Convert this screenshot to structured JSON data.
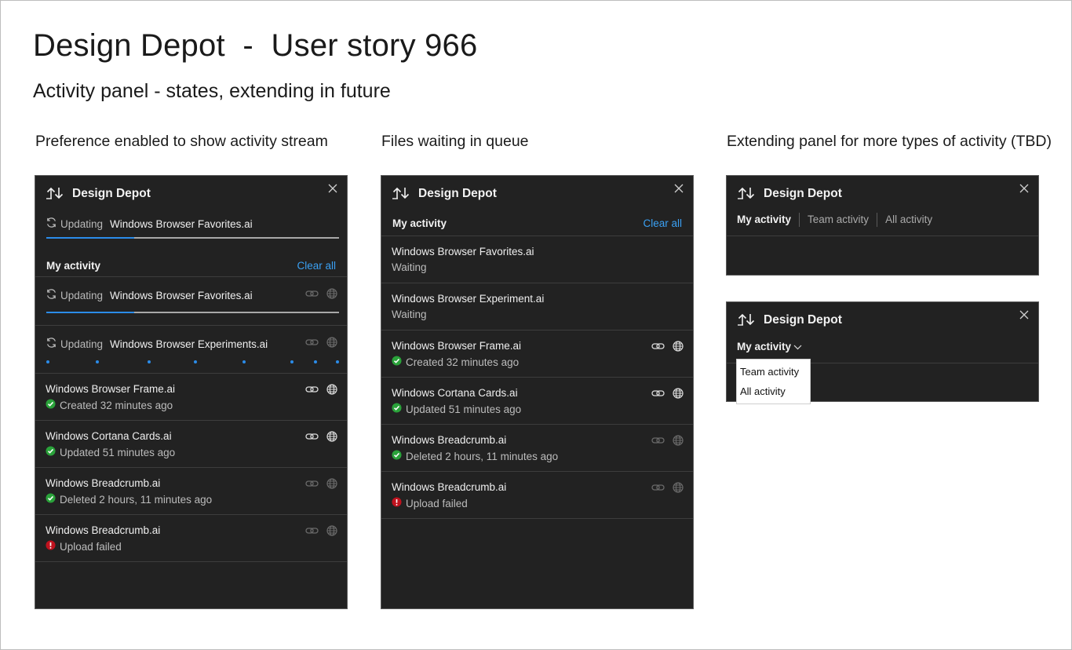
{
  "page": {
    "title": "Design Depot  -  User story 966",
    "subtitle": "Activity panel - states, extending in future"
  },
  "columns": [
    {
      "caption": "Preference enabled to show activity stream"
    },
    {
      "caption": "Files waiting in queue"
    },
    {
      "caption": "Extending panel for more types of activity (TBD)"
    }
  ],
  "app_name": "Design Depot",
  "panel1": {
    "top_update": {
      "status": "Updating",
      "file": "Windows Browser Favorites.ai",
      "progress": 0.3
    },
    "section_label": "My activity",
    "clear_all": "Clear all",
    "updating": [
      {
        "status": "Updating",
        "file": "Windows Browser Favorites.ai",
        "progress": 0.3
      },
      {
        "status": "Updating",
        "file": "Windows Browser Experiments.ai",
        "progress": "indeterminate"
      }
    ],
    "items": [
      {
        "file": "Windows Browser Frame.ai",
        "meta": "Created 32 minutes ago",
        "state": "success",
        "actions_enabled": true
      },
      {
        "file": "Windows Cortana Cards.ai",
        "meta": "Updated 51 minutes ago",
        "state": "success",
        "actions_enabled": true
      },
      {
        "file": "Windows Breadcrumb.ai",
        "meta": "Deleted 2 hours, 11 minutes ago",
        "state": "success",
        "actions_enabled": false
      },
      {
        "file": "Windows Breadcrumb.ai",
        "meta": "Upload failed",
        "state": "error",
        "actions_enabled": false
      }
    ]
  },
  "panel2": {
    "section_label": "My activity",
    "clear_all": "Clear all",
    "items": [
      {
        "file": "Windows Browser Favorites.ai",
        "meta": "Waiting",
        "state": "waiting",
        "actions": false
      },
      {
        "file": "Windows Browser Experiment.ai",
        "meta": "Waiting",
        "state": "waiting",
        "actions": false
      },
      {
        "file": "Windows Browser Frame.ai",
        "meta": "Created 32 minutes ago",
        "state": "success",
        "actions": true,
        "actions_enabled": true
      },
      {
        "file": "Windows Cortana Cards.ai",
        "meta": "Updated 51 minutes ago",
        "state": "success",
        "actions": true,
        "actions_enabled": true
      },
      {
        "file": "Windows Breadcrumb.ai",
        "meta": "Deleted 2 hours, 11 minutes ago",
        "state": "success",
        "actions": true,
        "actions_enabled": false
      },
      {
        "file": "Windows Breadcrumb.ai",
        "meta": "Upload failed",
        "state": "error",
        "actions": true,
        "actions_enabled": false
      }
    ]
  },
  "panel3": {
    "tabs": [
      "My activity",
      "Team activity",
      "All activity"
    ]
  },
  "panel4": {
    "selected": "My activity",
    "options": [
      "Team activity",
      "All activity"
    ]
  },
  "icons": {
    "logo": "sync-arrows-icon",
    "close": "close-icon",
    "link": "link-icon",
    "globe": "globe-icon",
    "refresh": "refresh-icon",
    "success": "check-circle-icon",
    "error": "error-circle-icon"
  },
  "colors": {
    "panel_bg": "#222222",
    "accent": "#2b8ce9",
    "link": "#3aa0f3",
    "success": "#2aa23a",
    "error": "#c0121e"
  }
}
